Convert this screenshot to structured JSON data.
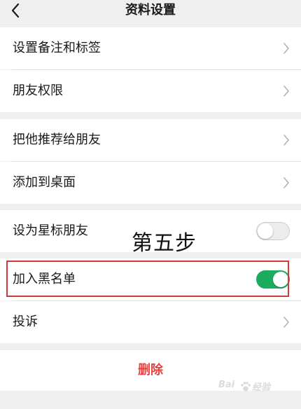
{
  "header": {
    "title": "资料设置",
    "back_icon": "chevron-left-icon"
  },
  "groups": [
    {
      "items": [
        {
          "label": "设置备注和标签",
          "type": "link",
          "icon": "chevron-right-icon"
        },
        {
          "label": "朋友权限",
          "type": "link",
          "icon": "chevron-right-icon"
        }
      ]
    },
    {
      "items": [
        {
          "label": "把他推荐给朋友",
          "type": "link",
          "icon": "chevron-right-icon"
        },
        {
          "label": "添加到桌面",
          "type": "link",
          "icon": "chevron-right-icon"
        }
      ]
    },
    {
      "items": [
        {
          "label": "设为星标朋友",
          "type": "toggle",
          "on": false
        }
      ]
    },
    {
      "items": [
        {
          "label": "加入黑名单",
          "type": "toggle",
          "on": true
        },
        {
          "label": "投诉",
          "type": "link",
          "icon": "chevron-right-icon"
        }
      ]
    }
  ],
  "delete_label": "删除",
  "annotation": {
    "step_text": "第五步",
    "highlight_color": "#d23a3a"
  },
  "colors": {
    "toggle_on": "#1aad5e",
    "delete_text": "#e64340",
    "background": "#efefef"
  }
}
